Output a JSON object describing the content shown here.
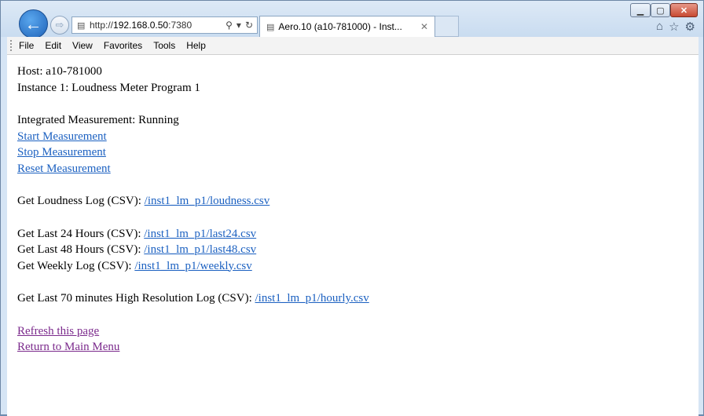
{
  "browser": {
    "address": {
      "prefix": "http://",
      "host": "192.168.0.50",
      "rest": ":7380"
    },
    "tab_title": "Aero.10 (a10-781000) - Inst...",
    "menu": [
      "File",
      "Edit",
      "View",
      "Favorites",
      "Tools",
      "Help"
    ]
  },
  "page": {
    "host_line": "Host: a10-781000",
    "instance_line": "Instance 1: Loudness Meter Program 1",
    "measurement_status": "Integrated Measurement: Running",
    "start_link": "Start Measurement",
    "stop_link": "Stop Measurement",
    "reset_link": "Reset Measurement",
    "loudness_log_label": "Get Loudness Log (CSV): ",
    "loudness_log_link": "/inst1_lm_p1/loudness.csv",
    "last24_label": "Get Last 24 Hours (CSV): ",
    "last24_link": "/inst1_lm_p1/last24.csv",
    "last48_label": "Get Last 48 Hours (CSV): ",
    "last48_link": "/inst1_lm_p1/last48.csv",
    "weekly_label": "Get Weekly Log (CSV): ",
    "weekly_link": "/inst1_lm_p1/weekly.csv",
    "hourly_label": "Get Last 70 minutes High Resolution Log (CSV): ",
    "hourly_link": "/inst1_lm_p1/hourly.csv",
    "refresh_link": "Refresh this page",
    "return_link": "Return to Main Menu"
  },
  "colors": {
    "link": "#1c61c1",
    "visited_link": "#7b2a8c"
  }
}
